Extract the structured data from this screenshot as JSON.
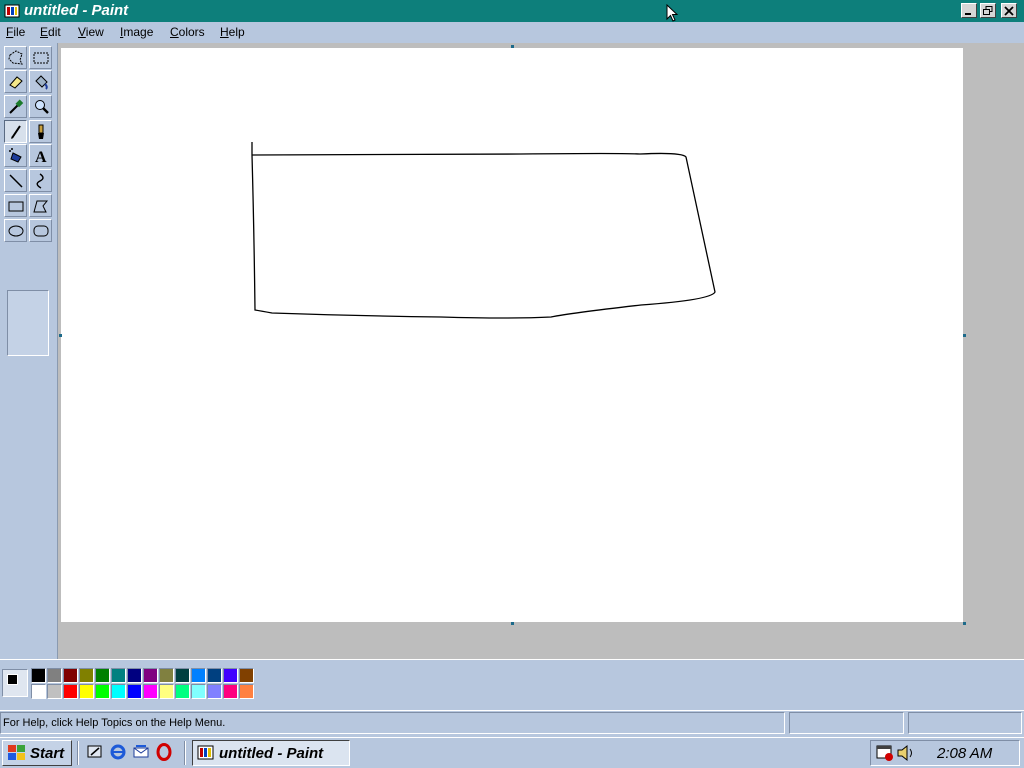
{
  "window": {
    "title": "untitled - Paint",
    "buttons": [
      "minimize",
      "restore",
      "close"
    ]
  },
  "menu": {
    "items": [
      {
        "label": "File",
        "key": "F",
        "rest": "ile"
      },
      {
        "label": "Edit",
        "key": "E",
        "rest": "dit"
      },
      {
        "label": "View",
        "key": "V",
        "rest": "iew"
      },
      {
        "label": "Image",
        "key": "I",
        "rest": "mage"
      },
      {
        "label": "Colors",
        "key": "C",
        "rest": "olors"
      },
      {
        "label": "Help",
        "key": "H",
        "rest": "elp"
      }
    ]
  },
  "toolbox": {
    "tools": [
      "free-form-select",
      "select",
      "eraser",
      "fill-with-color",
      "pick-color",
      "magnifier",
      "pencil",
      "brush",
      "airbrush",
      "text",
      "line",
      "curve",
      "rectangle",
      "polygon",
      "ellipse",
      "rounded-rectangle"
    ],
    "active_tool": "pencil",
    "text_tool_glyph": "A"
  },
  "palette": {
    "foreground": "#000000",
    "background": "#ffffff",
    "top_row": [
      "#000000",
      "#808080",
      "#800000",
      "#808000",
      "#008000",
      "#008080",
      "#000080",
      "#800080",
      "#808040",
      "#004040",
      "#0080ff",
      "#004080",
      "#4000ff",
      "#804000"
    ],
    "bottom_row": [
      "#ffffff",
      "#c0c0c0",
      "#ff0000",
      "#ffff00",
      "#00ff00",
      "#00ffff",
      "#0000ff",
      "#ff00ff",
      "#ffff80",
      "#00ff80",
      "#80ffff",
      "#8080ff",
      "#ff0080",
      "#ff8040"
    ]
  },
  "status": {
    "help_text": "For Help, click Help Topics on the Help Menu."
  },
  "taskbar": {
    "start_label": "Start",
    "quick_launch": [
      "show-desktop-icon",
      "internet-explorer-icon",
      "outlook-express-icon",
      "opera-icon"
    ],
    "task_label": "untitled - Paint",
    "tray_icons": [
      "scheduler-icon",
      "volume-icon"
    ],
    "clock": "2:08 AM"
  }
}
